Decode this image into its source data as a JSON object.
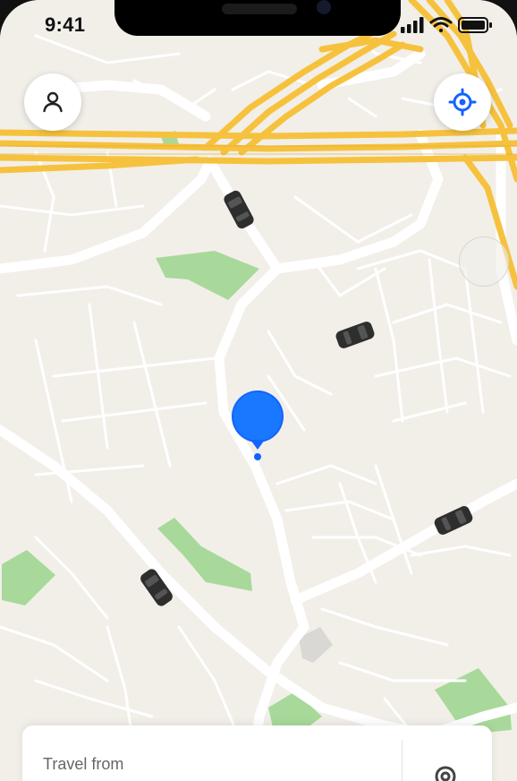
{
  "status_bar": {
    "time": "9:41"
  },
  "map": {
    "buttons": {
      "profile_icon": "person-icon",
      "locate_icon": "crosshair-icon"
    },
    "pin_color": "#1463ff",
    "cars": [
      "car-1",
      "car-2",
      "car-3",
      "car-4",
      "car-5"
    ]
  },
  "bottom_sheet": {
    "label": "Travel from",
    "icon": "location-pin-icon"
  },
  "colors": {
    "map_background": "#f2efe9",
    "road": "#ffffff",
    "highway": "#f6c23e",
    "park": "#a8d99a",
    "accent": "#1463ff"
  }
}
